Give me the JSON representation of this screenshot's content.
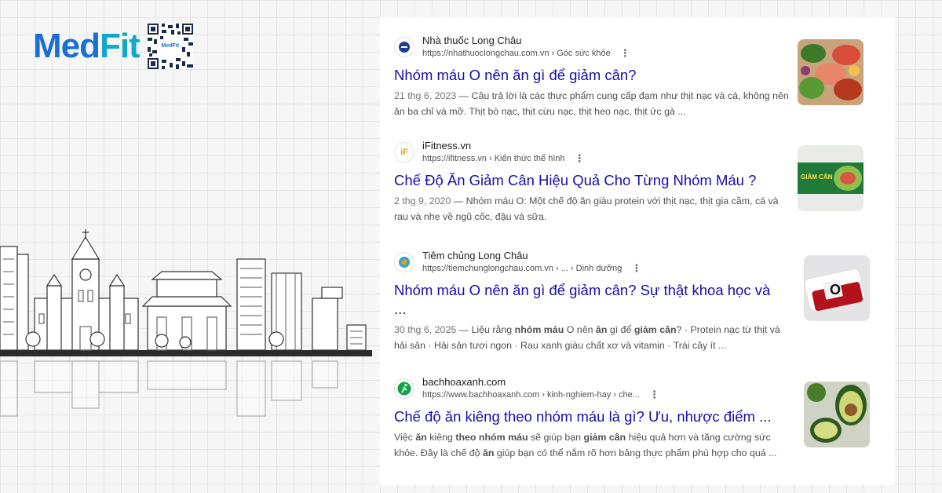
{
  "brand": {
    "logo_part1": "Med",
    "logo_part2": "Fit",
    "qr_label": "MedFit"
  },
  "results": [
    {
      "site_name": "Nhà thuốc Long Châu",
      "url": "https://nhathuoclongchau.com.vn › Góc sức khỏe",
      "title": "Nhóm máu O nên ăn gì để giảm cân?",
      "date": "21 thg 6, 2023",
      "snippet": " — Câu trả lời là các thực phẩm cung cấp đạm như thịt nạc và cá, không nên ăn ba chỉ và mỡ. Thịt bò nạc, thịt cừu nạc, thịt heo nạc, thịt ức gà ...",
      "thumb_icon": "food-platter-image"
    },
    {
      "site_name": "iFitness.vn",
      "url": "https://ifitness.vn › Kiến thức thể hình",
      "title": "Chế Độ Ăn Giảm Cân Hiệu Quả Cho Từng Nhóm Máu ?",
      "date": "2 thg 9, 2020",
      "snippet": " — Nhóm máu O: Một chế độ ăn giàu protein với thịt nạc, thịt gia cầm, cá và rau và nhẹ về ngũ cốc, đậu và sữa.",
      "favicon_text": "iF",
      "thumb_text": "GIẢM CÂN",
      "thumb_icon": "salad-banner-image"
    },
    {
      "site_name": "Tiêm chủng Long Châu",
      "url": "https://tiemchunglongchau.com.vn › ... › Dinh dưỡng",
      "title": "Nhóm máu O nên ăn gì để giảm cân? Sự thật khoa học và ...",
      "date": "30 thg 6, 2025",
      "snippet_parts": [
        " — Liệu rằng ",
        "nhóm máu",
        " O nên ",
        "ăn",
        " gì để ",
        "giảm cân",
        "? · Protein nạc từ thịt và hải sản · Hải sản tươi ngon · Rau xanh giàu chất xơ và vitamin · Trái cây ít ..."
      ],
      "thumb_text": "O",
      "thumb_icon": "blood-bag-image"
    },
    {
      "site_name": "bachhoaxanh.com",
      "url": "https://www.bachhoaxanh.com › kinh-nghiem-hay › che...",
      "title": "Chế độ ăn kiêng theo nhóm máu là gì? Ưu, nhược điểm ...",
      "snippet_parts": [
        "Việc ",
        "ăn",
        " kiêng ",
        "theo nhóm máu",
        " sẽ giúp bạn ",
        "giảm cân",
        " hiệu quả hơn và tăng cường sức khỏe. Đây là chế độ ",
        "ăn",
        " giúp bạn có thể nắm rõ hơn bảng thực phẩm phù hợp cho quá ..."
      ],
      "thumb_icon": "avocado-image"
    }
  ],
  "colors": {
    "link": "#1a0dab",
    "snippet": "#4d5156",
    "brand_blue": "#1c6fd4",
    "brand_cyan": "#12a9c9"
  }
}
